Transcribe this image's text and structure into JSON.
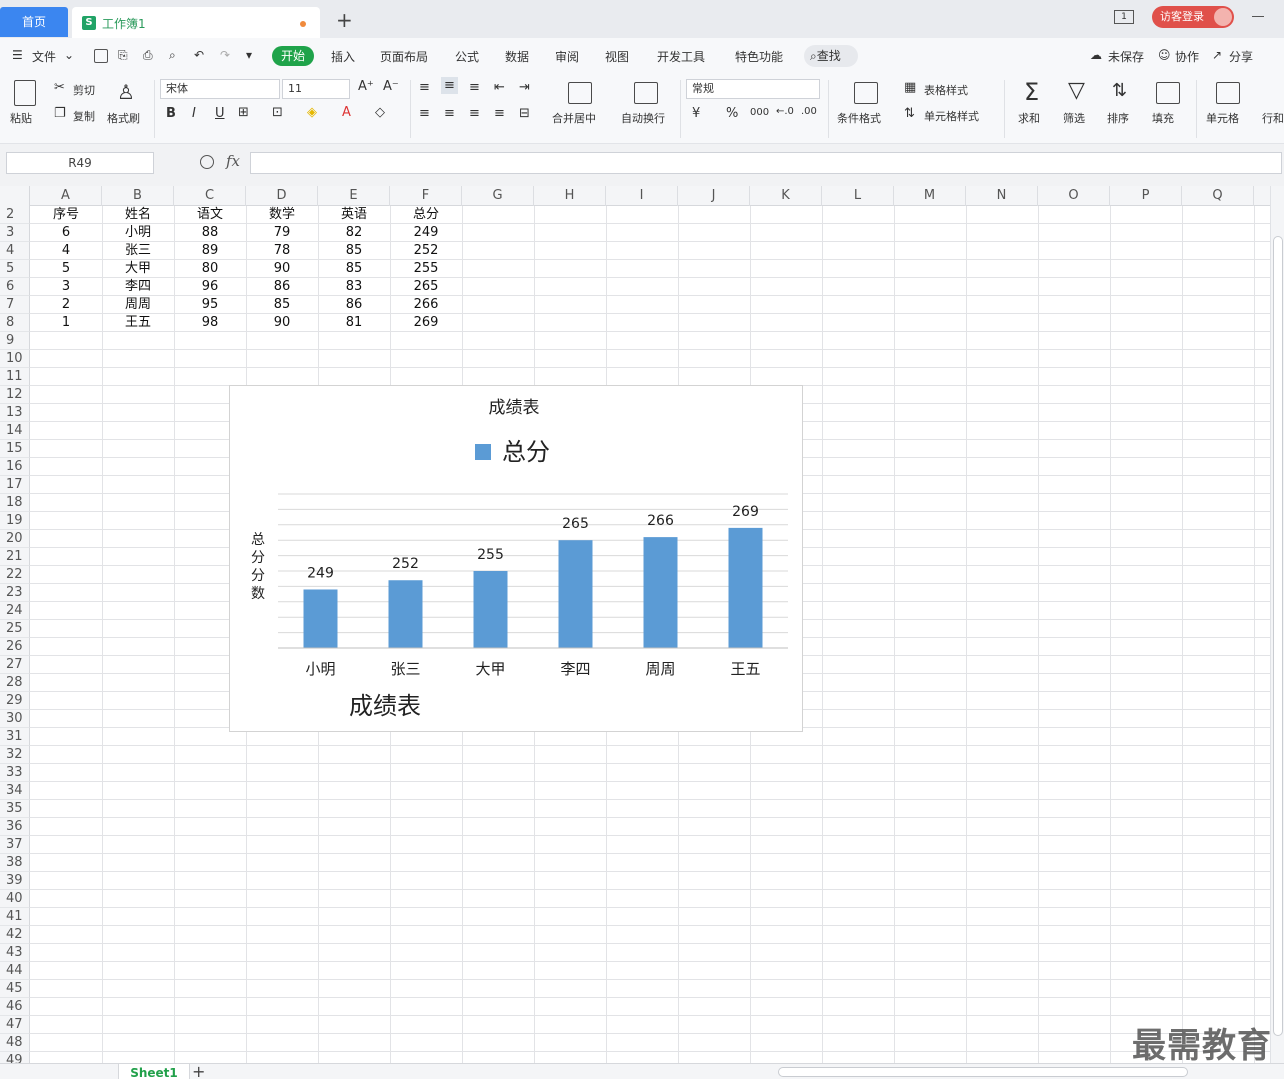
{
  "tabs": {
    "home": "首页",
    "doc_title": "工作簿1",
    "doc_icon": "S",
    "new_tab": "+",
    "pages_icon": "1"
  },
  "account": {
    "login": "访客登录"
  },
  "menu": {
    "file": "文件",
    "items": [
      "开始",
      "插入",
      "页面布局",
      "公式",
      "数据",
      "审阅",
      "视图",
      "开发工具",
      "特色功能"
    ],
    "search": "查找",
    "right": [
      "未保存",
      "协作",
      "分享"
    ]
  },
  "ribbon": {
    "paste": "粘贴",
    "cut": "剪切",
    "copy": "复制",
    "format_painter": "格式刷",
    "font_name": "宋体",
    "font_size": "11",
    "bold": "B",
    "italic": "I",
    "underline": "U",
    "merge_center": "合并居中",
    "wrap_text": "自动换行",
    "number_format": "常规",
    "currency": "¥",
    "percent": "%",
    "thousands": "000",
    "conditional_format": "条件格式",
    "table_style": "表格样式",
    "cell_style": "单元格样式",
    "sum": "求和",
    "filter": "筛选",
    "sort": "排序",
    "fill": "填充",
    "cells": "单元格",
    "rows_cols": "行和"
  },
  "formula_bar": {
    "name_box": "R49",
    "fx": "fx",
    "value": ""
  },
  "columns": [
    "A",
    "B",
    "C",
    "D",
    "E",
    "F",
    "G",
    "H",
    "I",
    "J",
    "K",
    "L",
    "M",
    "N",
    "O",
    "P",
    "Q"
  ],
  "rows_start": 2,
  "rows_end": 49,
  "table": {
    "headers": [
      "序号",
      "姓名",
      "语文",
      "数学",
      "英语",
      "总分"
    ],
    "rows": [
      [
        "6",
        "小明",
        "88",
        "79",
        "82",
        "249"
      ],
      [
        "4",
        "张三",
        "89",
        "78",
        "85",
        "252"
      ],
      [
        "5",
        "大甲",
        "80",
        "90",
        "85",
        "255"
      ],
      [
        "3",
        "李四",
        "96",
        "86",
        "83",
        "265"
      ],
      [
        "2",
        "周周",
        "95",
        "85",
        "86",
        "266"
      ],
      [
        "1",
        "王五",
        "98",
        "90",
        "81",
        "269"
      ]
    ]
  },
  "chart_data": {
    "type": "bar",
    "title": "成绩表",
    "legend": [
      "总分"
    ],
    "legend_position": "top",
    "ylabel": "总分分数",
    "xlabel": "成绩表",
    "categories": [
      "小明",
      "张三",
      "大甲",
      "李四",
      "周周",
      "王五"
    ],
    "series": [
      {
        "name": "总分",
        "values": [
          249,
          252,
          255,
          265,
          266,
          269
        ],
        "color": "#5b9bd5"
      }
    ],
    "ylim": [
      230,
      280
    ],
    "grid": true,
    "data_labels": true
  },
  "sheets": {
    "active": "Sheet1",
    "add": "+"
  },
  "watermark": "最需教育"
}
